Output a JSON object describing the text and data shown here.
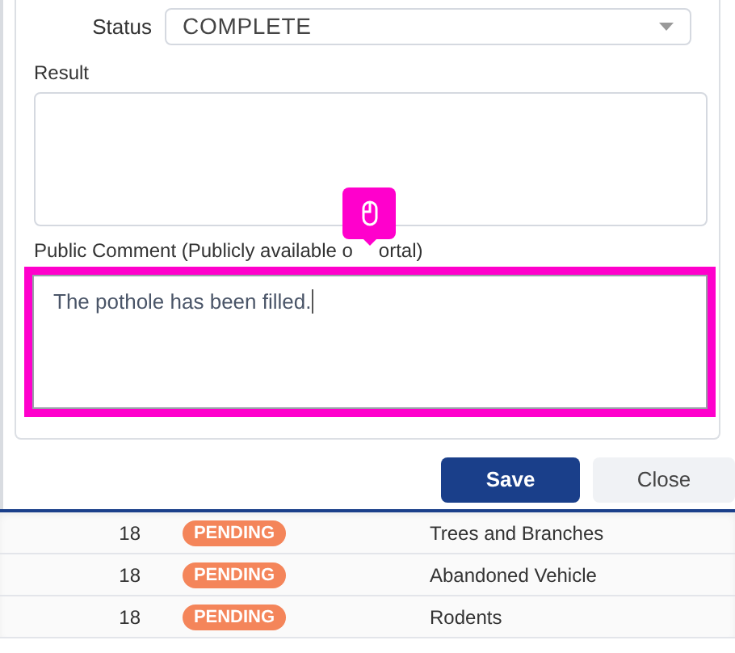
{
  "form": {
    "status_label": "Status",
    "status_value": "COMPLETE",
    "result_label": "Result",
    "comment_label_parts": [
      "Public Comment (Publicly available o",
      "ortal)"
    ],
    "comment_value": "The pothole has been filled.",
    "comment_focused": true
  },
  "buttons": [
    {
      "label": "Save",
      "kind": "primary"
    },
    {
      "label": "Close",
      "kind": "secondary"
    }
  ],
  "rows": [
    {
      "column_1": "18",
      "status": "PENDING",
      "category": "Trees and Branches"
    },
    {
      "column_1": "18",
      "status": "PENDING",
      "category": "Abandoned Vehicle"
    },
    {
      "column_1": "18",
      "status": "PENDING",
      "category": "Rodents"
    }
  ]
}
